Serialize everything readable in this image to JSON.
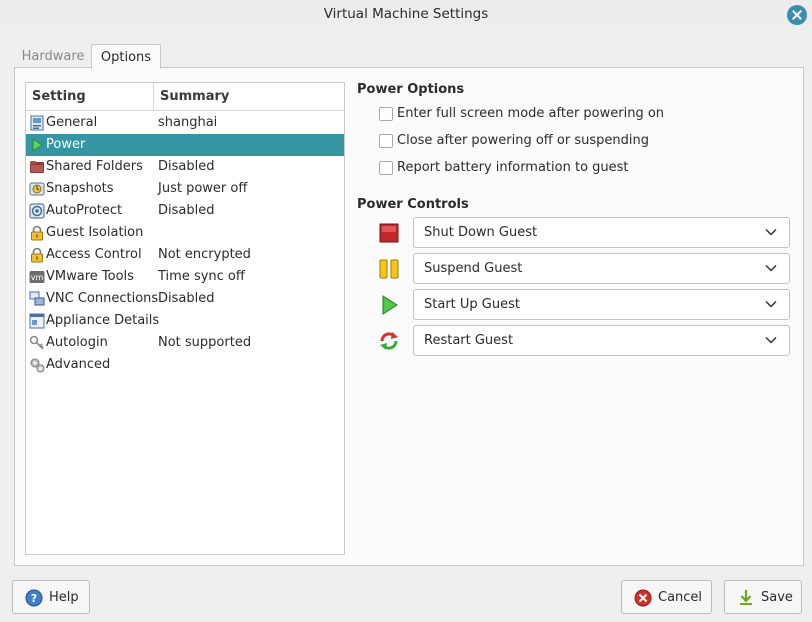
{
  "window": {
    "title": "Virtual Machine Settings"
  },
  "tabs": [
    {
      "label": "Hardware"
    },
    {
      "label": "Options"
    }
  ],
  "settings_list": {
    "headers": {
      "setting": "Setting",
      "summary": "Summary"
    },
    "rows": [
      {
        "label": "General",
        "summary": "shanghai",
        "icon": "general-icon"
      },
      {
        "label": "Power",
        "summary": "",
        "icon": "power-play-icon",
        "selected": true
      },
      {
        "label": "Shared Folders",
        "summary": "Disabled",
        "icon": "shared-folders-icon"
      },
      {
        "label": "Snapshots",
        "summary": "Just power off",
        "icon": "snapshots-icon"
      },
      {
        "label": "AutoProtect",
        "summary": "Disabled",
        "icon": "autoprotect-icon"
      },
      {
        "label": "Guest Isolation",
        "summary": "",
        "icon": "lock-icon"
      },
      {
        "label": "Access Control",
        "summary": "Not encrypted",
        "icon": "lock-icon"
      },
      {
        "label": "VMware Tools",
        "summary": "Time sync off",
        "icon": "vmware-tools-icon"
      },
      {
        "label": "VNC Connections",
        "summary": "Disabled",
        "icon": "vnc-icon"
      },
      {
        "label": "Appliance Details",
        "summary": "",
        "icon": "appliance-icon"
      },
      {
        "label": "Autologin",
        "summary": "Not supported",
        "icon": "key-icon"
      },
      {
        "label": "Advanced",
        "summary": "",
        "icon": "gears-icon"
      }
    ]
  },
  "power_options": {
    "title": "Power Options",
    "checkboxes": [
      {
        "label": "Enter full screen mode after powering on",
        "checked": false
      },
      {
        "label": "Close after powering off or suspending",
        "checked": false
      },
      {
        "label": "Report battery information to guest",
        "checked": false
      }
    ]
  },
  "power_controls": {
    "title": "Power Controls",
    "controls": [
      {
        "icon": "stop-icon",
        "value": "Shut Down Guest"
      },
      {
        "icon": "pause-icon",
        "value": "Suspend Guest"
      },
      {
        "icon": "play-icon",
        "value": "Start Up Guest"
      },
      {
        "icon": "restart-icon",
        "value": "Restart Guest"
      }
    ]
  },
  "buttons": {
    "help": "Help",
    "cancel": "Cancel",
    "save": "Save"
  },
  "colors": {
    "selection": "#3596a3",
    "close_button": "#3a8fb0"
  }
}
